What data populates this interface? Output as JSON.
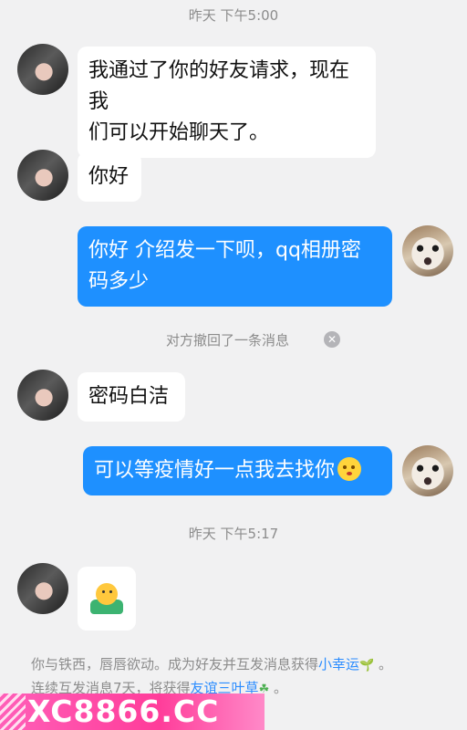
{
  "timestamps": [
    "昨天 下午5:00",
    "昨天 下午5:17"
  ],
  "messages": [
    {
      "text": "我通过了你的好友请求，现在我们可以开始聊天了。",
      "line1": "我通过了你的好友请求，现在我",
      "line2": "们可以开始聊天了。"
    },
    {
      "text": "你好"
    },
    {
      "text": "你好 介绍发一下呗，qq相册密码多少",
      "line1": "你好 介绍发一下呗，qq相册密",
      "line2": "码多少"
    },
    {
      "text": "密码白洁"
    },
    {
      "text": "可以等疫情好一点我去找你"
    }
  ],
  "recall_notice": "对方撤回了一条消息",
  "system_notice": {
    "line1_prefix": "你与铁西，唇唇欲动。成为好友并互发消息获得",
    "link1": "小幸运",
    "line1_suffix": "。",
    "line2_prefix": "连续互发消息7天，将获得",
    "link2": "友谊三叶草",
    "line2_suffix": "。"
  },
  "watermark": "XC8866.CC",
  "icons": {
    "recall_close": "close-icon",
    "emoji": "blush-face-emoji",
    "sticker": "person-sticker",
    "sprout": "sprout-icon",
    "clover": "clover-icon"
  },
  "colors": {
    "background": "#f1f1f2",
    "outgoing_bubble": "#1e90ff",
    "incoming_bubble": "#ffffff",
    "link": "#2a8cff",
    "watermark": "#ff3d9a"
  }
}
